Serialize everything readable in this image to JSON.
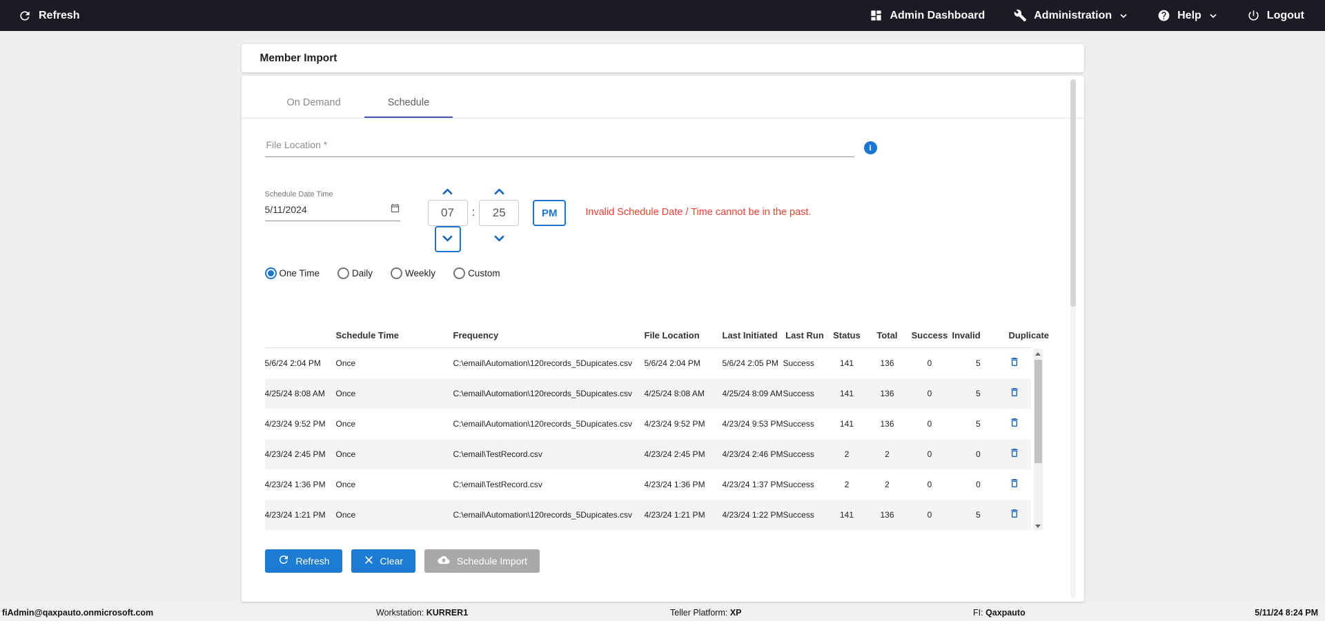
{
  "topbar": {
    "refresh_label": "Refresh",
    "admin_dashboard_label": "Admin Dashboard",
    "administration_label": "Administration",
    "help_label": "Help",
    "logout_label": "Logout"
  },
  "page": {
    "title": "Member Import"
  },
  "tabs": {
    "on_demand": "On Demand",
    "schedule": "Schedule"
  },
  "form": {
    "file_location_placeholder": "File Location *",
    "schedule_datetime_label": "Schedule Date Time",
    "date_value": "5/11/2024",
    "hour": "07",
    "time_separator": ":",
    "minute": "25",
    "meridiem": "PM",
    "error_message": "Invalid Schedule Date / Time cannot be in the past.",
    "frequency_options": [
      {
        "label": "One Time",
        "selected": true
      },
      {
        "label": "Daily",
        "selected": false
      },
      {
        "label": "Weekly",
        "selected": false
      },
      {
        "label": "Custom",
        "selected": false
      }
    ]
  },
  "table": {
    "headers": [
      "Schedule Time",
      "Frequency",
      "File Location",
      "Last Initiated",
      "Last Run",
      "Status",
      "Total",
      "Success",
      "Invalid",
      "Duplicate"
    ],
    "rows": [
      {
        "schedule_time": "5/6/24 2:04 PM",
        "frequency": "Once",
        "file_location": "C:\\email\\Automation\\120records_5Dupicates.csv",
        "last_initiated": "5/6/24 2:04 PM",
        "last_run": "5/6/24 2:05 PM",
        "status": "Success",
        "total": "141",
        "success": "136",
        "invalid": "0",
        "duplicate": "5"
      },
      {
        "schedule_time": "4/25/24 8:08 AM",
        "frequency": "Once",
        "file_location": "C:\\email\\Automation\\120records_5Dupicates.csv",
        "last_initiated": "4/25/24 8:08 AM",
        "last_run": "4/25/24 8:09 AM",
        "status": "Success",
        "total": "141",
        "success": "136",
        "invalid": "0",
        "duplicate": "5"
      },
      {
        "schedule_time": "4/23/24 9:52 PM",
        "frequency": "Once",
        "file_location": "C:\\email\\Automation\\120records_5Dupicates.csv",
        "last_initiated": "4/23/24 9:52 PM",
        "last_run": "4/23/24 9:53 PM",
        "status": "Success",
        "total": "141",
        "success": "136",
        "invalid": "0",
        "duplicate": "5"
      },
      {
        "schedule_time": "4/23/24 2:45 PM",
        "frequency": "Once",
        "file_location": "C:\\email\\TestRecord.csv",
        "last_initiated": "4/23/24 2:45 PM",
        "last_run": "4/23/24 2:46 PM",
        "status": "Success",
        "total": "2",
        "success": "2",
        "invalid": "0",
        "duplicate": "0"
      },
      {
        "schedule_time": "4/23/24 1:36 PM",
        "frequency": "Once",
        "file_location": "C:\\email\\TestRecord.csv",
        "last_initiated": "4/23/24 1:36 PM",
        "last_run": "4/23/24 1:37 PM",
        "status": "Success",
        "total": "2",
        "success": "2",
        "invalid": "0",
        "duplicate": "0"
      },
      {
        "schedule_time": "4/23/24 1:21 PM",
        "frequency": "Once",
        "file_location": "C:\\email\\Automation\\120records_5Dupicates.csv",
        "last_initiated": "4/23/24 1:21 PM",
        "last_run": "4/23/24 1:22 PM",
        "status": "Success",
        "total": "141",
        "success": "136",
        "invalid": "0",
        "duplicate": "5"
      }
    ]
  },
  "actions": {
    "refresh_label": "Refresh",
    "clear_label": "Clear",
    "schedule_import_label": "Schedule Import"
  },
  "footer": {
    "user": "fiAdmin@qaxpauto.onmicrosoft.com",
    "workstation_label": "Workstation:",
    "workstation_value": "KURRER1",
    "teller_label": "Teller Platform:",
    "teller_value": "XP",
    "fi_label": "FI:",
    "fi_value": "Qaxpauto",
    "datetime": "5/11/24 8:24 PM"
  },
  "icons": [
    "refresh-icon",
    "dashboard-icon",
    "wrench-icon",
    "help-icon",
    "chevron-down-icon",
    "power-icon",
    "info-icon",
    "calendar-icon",
    "caret-up-icon",
    "caret-down-icon",
    "trash-icon",
    "clear-x-icon",
    "cloud-upload-icon"
  ],
  "colors": {
    "topbar_bg": "#1b1b25",
    "accent_blue": "#1976d2",
    "button_blue": "#1c7cd4",
    "caret_blue": "#1565c0",
    "tab_underline": "#3f51b5",
    "error_red": "#f44336",
    "disabled_gray": "#a9a9a9"
  }
}
